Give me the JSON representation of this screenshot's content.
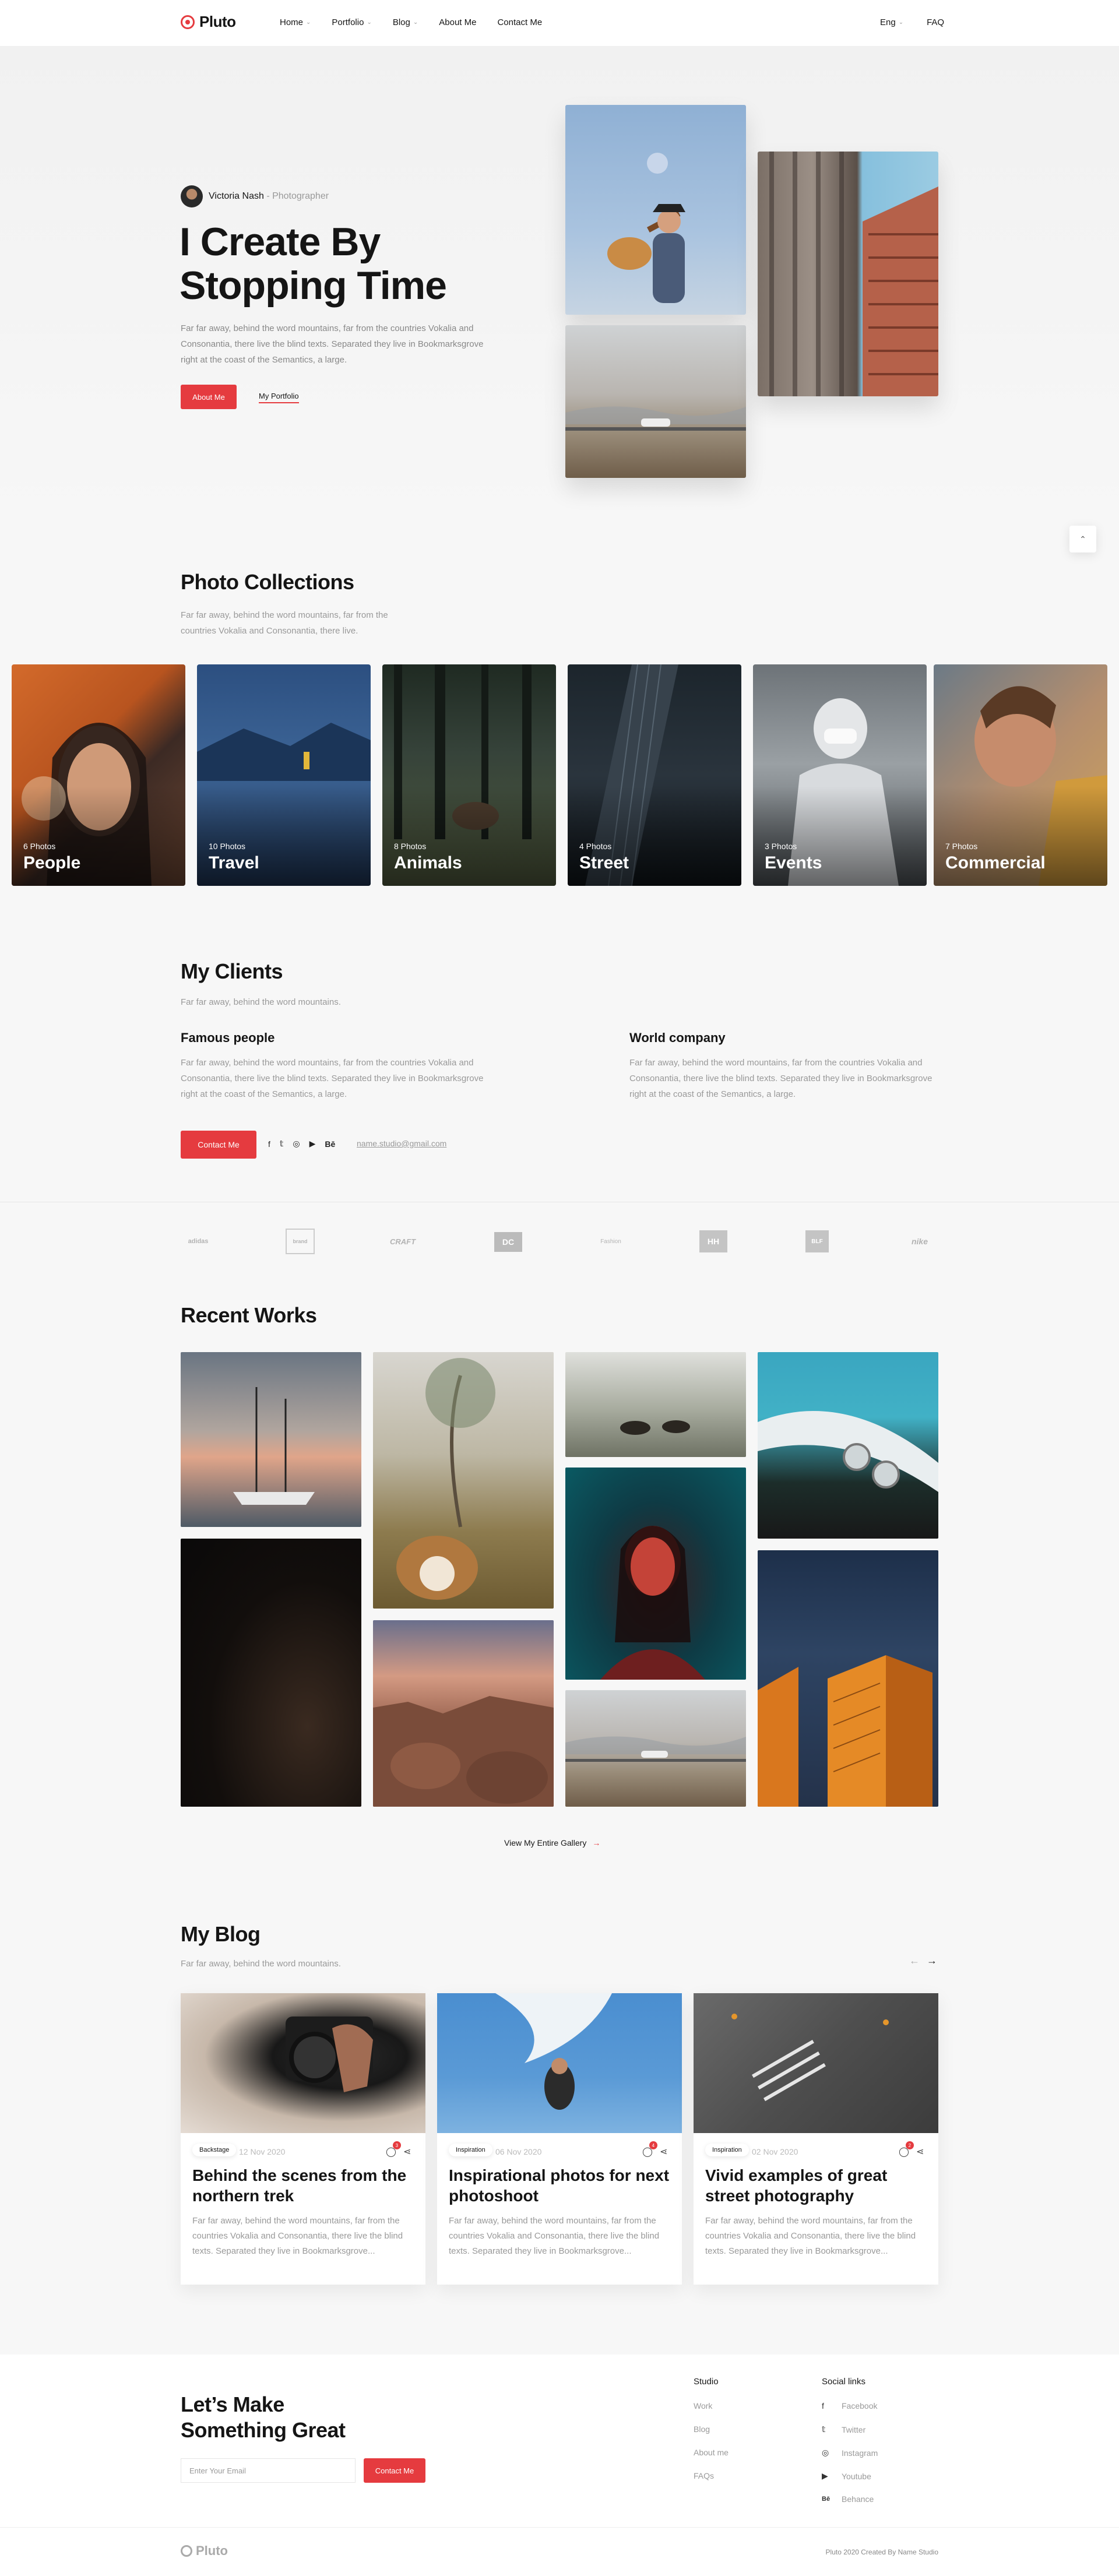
{
  "header": {
    "logo": "Pluto",
    "nav": [
      {
        "label": "Home",
        "has_menu": true
      },
      {
        "label": "Portfolio",
        "has_menu": true
      },
      {
        "label": "Blog",
        "has_menu": true
      },
      {
        "label": "About Me",
        "has_menu": false
      },
      {
        "label": "Contact Me",
        "has_menu": false
      }
    ],
    "lang": "Eng",
    "faq": "FAQ"
  },
  "hero": {
    "name": "Victoria Nash",
    "role": "- Photographer",
    "title": "I Create By Stopping Time",
    "lead": "Far far away, behind the word mountains, far from the countries Vokalia and Consonantia, there live the blind texts. Separated they live in Bookmarksgrove right at the coast of the Semantics, a large.",
    "btn_primary": "About Me",
    "btn_link": "My Portfolio"
  },
  "collections": {
    "title": "Photo Collections",
    "sub": "Far far away, behind the word mountains, far from the countries Vokalia and Consonantia, there live.",
    "items": [
      {
        "count": "6 Photos",
        "name": "People"
      },
      {
        "count": "10 Photos",
        "name": "Travel"
      },
      {
        "count": "8 Photos",
        "name": "Animals"
      },
      {
        "count": "4 Photos",
        "name": "Street"
      },
      {
        "count": "3 Photos",
        "name": "Events"
      },
      {
        "count": "7 Photos",
        "name": "Commercial"
      }
    ]
  },
  "clients": {
    "title": "My Clients",
    "sub": "Far far away, behind the word mountains.",
    "cols": [
      {
        "title": "Famous people",
        "text": "Far far away, behind the word mountains, far from the countries Vokalia and Consonantia, there live the blind texts. Separated they live in Bookmarksgrove right at the coast of the Semantics, a large."
      },
      {
        "title": "World company",
        "text": "Far far away, behind the word mountains, far from the countries Vokalia and Consonantia, there live the blind texts. Separated they live in Bookmarksgrove right at the coast of the Semantics, a large."
      }
    ],
    "contact_btn": "Contact Me",
    "email": "name.studio@gmail.com"
  },
  "brands": [
    "adidas",
    "brand",
    "CRAFT",
    "DC",
    "Fashion",
    "HH",
    "BLF",
    "nike"
  ],
  "works": {
    "title": "Recent Works",
    "gallery_link": "View My Entire Gallery"
  },
  "blog": {
    "title": "My Blog",
    "sub": "Far far away, behind the word mountains.",
    "posts": [
      {
        "tag": "Backstage",
        "date": "12 Nov 2020",
        "comments": "3",
        "title": "Behind the scenes from the northern trek",
        "excerpt": "Far far away, behind the word mountains, far from the countries Vokalia and Consonantia, there live the blind texts. Separated they live in Bookmarksgrove..."
      },
      {
        "tag": "Inspiration",
        "date": "06 Nov 2020",
        "comments": "4",
        "title": "Inspirational photos for next photoshoot",
        "excerpt": "Far far away, behind the word mountains, far from the countries Vokalia and Consonantia, there live the blind texts. Separated they live in Bookmarksgrove..."
      },
      {
        "tag": "Inspiration",
        "date": "02 Nov 2020",
        "comments": "2",
        "title": "Vivid examples of great street photography",
        "excerpt": "Far far away, behind the word mountains, far from the countries Vokalia and Consonantia, there live the blind texts. Separated they live in Bookmarksgrove..."
      }
    ]
  },
  "footer": {
    "cta": "Let’s Make Something Great",
    "email_placeholder": "Enter Your Email",
    "cta_btn": "Contact Me",
    "studio_title": "Studio",
    "studio_links": [
      "Work",
      "Blog",
      "About me",
      "FAQs"
    ],
    "social_title": "Social links",
    "social_links": [
      "Facebook",
      "Twitter",
      "Instagram",
      "Youtube",
      "Behance"
    ],
    "logo": "Pluto",
    "copyright": "Pluto 2020 Created By Name Studio"
  },
  "colors": {
    "accent": "#e53b3f",
    "text": "#151515",
    "muted": "#999999"
  }
}
